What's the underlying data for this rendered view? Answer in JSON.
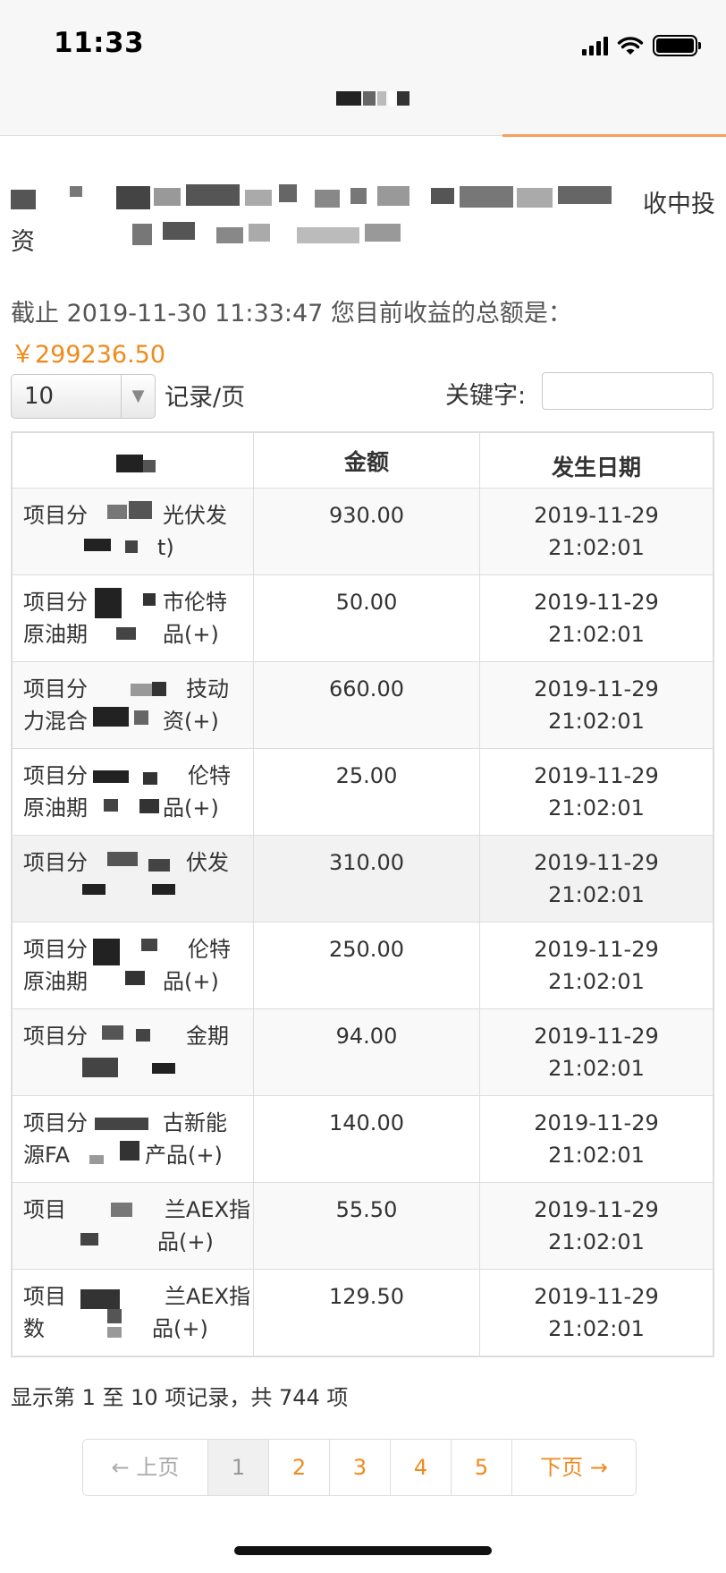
{
  "status_bar": {
    "time": "11:33"
  },
  "notice": {
    "tail": "收中投",
    "line2_head": "资"
  },
  "summary": {
    "prefix": "截止 2019-11-30 11:33:47 您目前收益的总额是：",
    "amount": "￥299236.50"
  },
  "controls": {
    "page_size_value": "10",
    "page_size_label": "记录/页",
    "keyword_label": "关键字:",
    "keyword_value": ""
  },
  "table": {
    "headers": [
      "",
      "金额",
      "发生日期"
    ],
    "rows": [
      {
        "name_l1": "项目分",
        "name_l1_end": "光伏发",
        "name_l2": "",
        "name_l2_end": "t)",
        "amount": "930.00",
        "date": "2019-11-29 21:02:01"
      },
      {
        "name_l1": "项目分",
        "name_l1_end": "市伦特",
        "name_l2": "原油期",
        "name_l2_end": "品(+)",
        "amount": "50.00",
        "date": "2019-11-29 21:02:01"
      },
      {
        "name_l1": "项目分",
        "name_l1_end": "技动",
        "name_l2": "力混合",
        "name_l2_end": "资(+)",
        "amount": "660.00",
        "date": "2019-11-29 21:02:01"
      },
      {
        "name_l1": "项目分",
        "name_l1_end": "伦特",
        "name_l2": "原油期",
        "name_l2_end": "品(+)",
        "amount": "25.00",
        "date": "2019-11-29 21:02:01"
      },
      {
        "name_l1": "项目分",
        "name_l1_end": "伏发",
        "name_l2": "",
        "name_l2_end": "",
        "amount": "310.00",
        "date": "2019-11-29 21:02:01"
      },
      {
        "name_l1": "项目分",
        "name_l1_end": "伦特",
        "name_l2": "原油期",
        "name_l2_end": "品(+)",
        "amount": "250.00",
        "date": "2019-11-29 21:02:01"
      },
      {
        "name_l1": "项目分",
        "name_l1_end": "金期",
        "name_l2": "",
        "name_l2_end": "",
        "amount": "94.00",
        "date": "2019-11-29 21:02:01"
      },
      {
        "name_l1": "项目分",
        "name_l1_end": "古新能",
        "name_l2": "源FA",
        "name_l2_end": "产品(+)",
        "amount": "140.00",
        "date": "2019-11-29 21:02:01"
      },
      {
        "name_l1": "项目",
        "name_l1_end": "兰AEX指",
        "name_l2": "",
        "name_l2_end": "品(+)",
        "amount": "55.50",
        "date": "2019-11-29 21:02:01"
      },
      {
        "name_l1": "项目",
        "name_l1_end": "兰AEX指",
        "name_l2": "数",
        "name_l2_end": "品(+)",
        "amount": "129.50",
        "date": "2019-11-29 21:02:01"
      }
    ]
  },
  "footer_info": "显示第 1 至 10 项记录，共 744 项",
  "pagination": {
    "prev": "← 上页",
    "pages": [
      "1",
      "2",
      "3",
      "4",
      "5"
    ],
    "active": "1",
    "next": "下页 →"
  },
  "colors": {
    "accent": "#f08a1c",
    "border": "#dddddd"
  },
  "icons": [
    "signal-icon",
    "wifi-icon",
    "battery-icon",
    "chevron-down-icon"
  ]
}
